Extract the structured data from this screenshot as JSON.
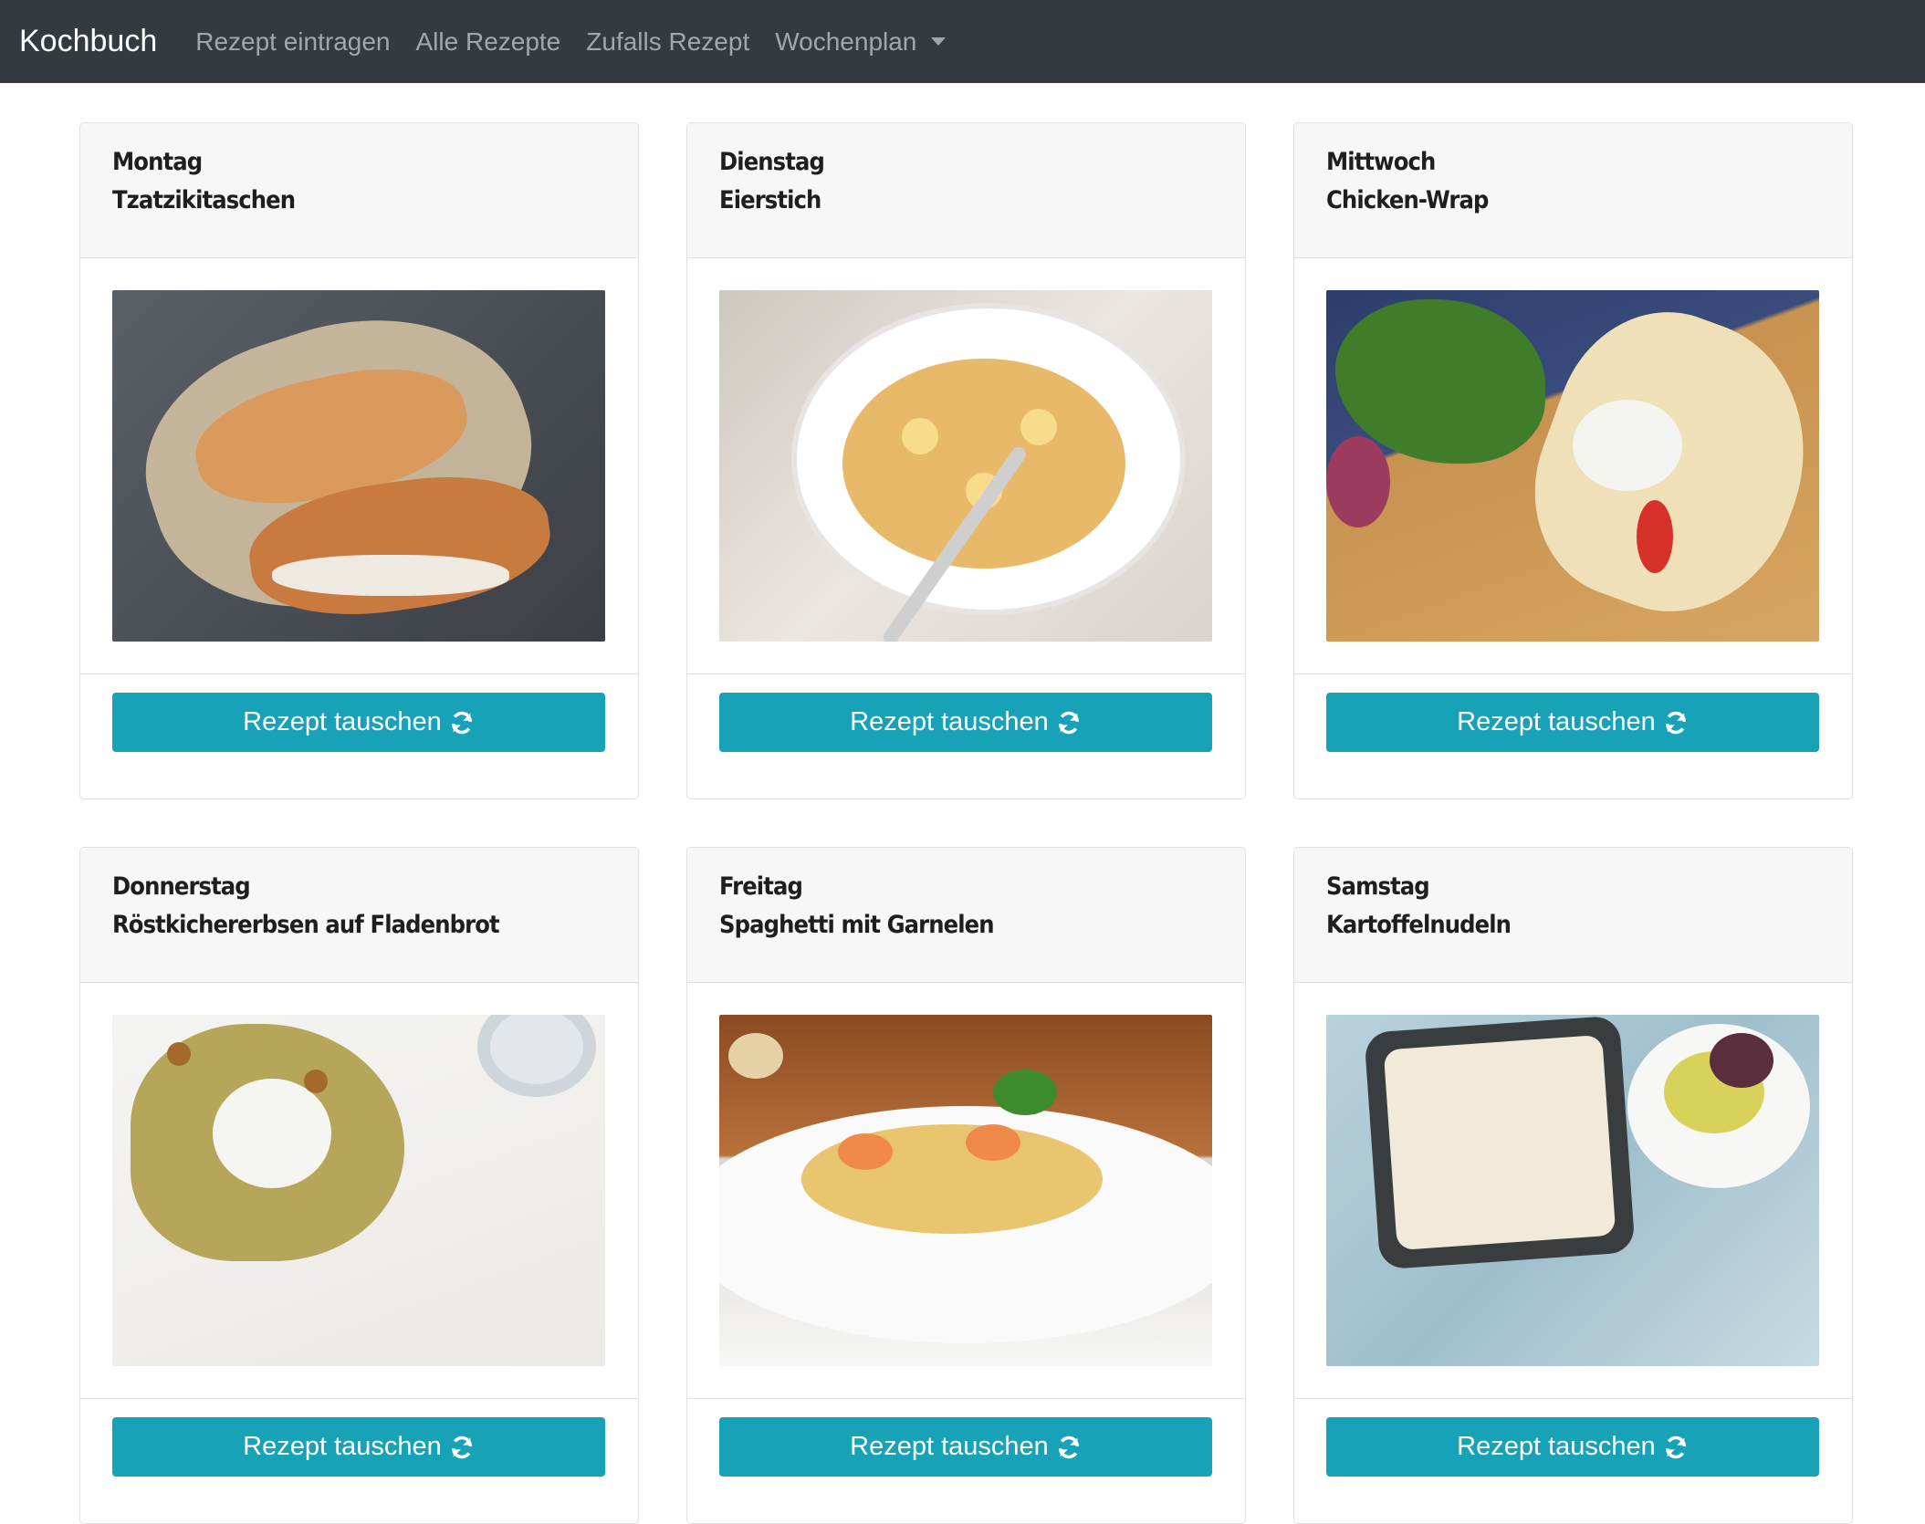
{
  "navbar": {
    "brand": "Kochbuch",
    "links": [
      {
        "label": "Rezept eintragen"
      },
      {
        "label": "Alle Rezepte"
      },
      {
        "label": "Zufalls Rezept"
      },
      {
        "label": "Wochenplan"
      }
    ]
  },
  "days": [
    {
      "day": "Montag",
      "recipe": "Tzatzikitaschen",
      "button": "Rezept tauschen"
    },
    {
      "day": "Dienstag",
      "recipe": "Eierstich",
      "button": "Rezept tauschen"
    },
    {
      "day": "Mittwoch",
      "recipe": "Chicken-Wrap",
      "button": "Rezept tauschen"
    },
    {
      "day": "Donnerstag",
      "recipe": "Röstkichererbsen auf Fladenbrot",
      "button": "Rezept tauschen"
    },
    {
      "day": "Freitag",
      "recipe": "Spaghetti mit Garnelen",
      "button": "Rezept tauschen"
    },
    {
      "day": "Samstag",
      "recipe": "Kartoffelnudeln",
      "button": "Rezept tauschen"
    }
  ],
  "colors": {
    "navbar": "#343a40",
    "button": "#17a2b8",
    "card_header": "#f7f7f7"
  }
}
